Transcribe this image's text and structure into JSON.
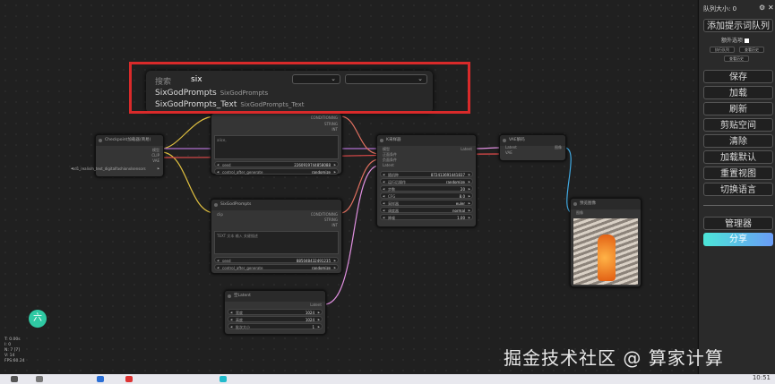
{
  "search": {
    "label": "搜索",
    "query": "six",
    "results": [
      {
        "name": "SixGodPrompts",
        "sub": "SixGodPrompts"
      },
      {
        "name": "SixGodPrompts_Text",
        "sub": "SixGodPrompts_Text"
      }
    ]
  },
  "nodes": {
    "checkpoint": {
      "title": "Checkpoint加载器(简易)",
      "ports": [
        "模型",
        "CLIP",
        "VAE"
      ],
      "widget": "sd1_realism_text_digitalfashionxlsensors"
    },
    "prompt_top": {
      "outputs": [
        "CONDITIONING",
        "STRING",
        "INT"
      ],
      "text": "alice,",
      "seed_label": "seed",
      "seed": "2260919744858088",
      "ctrl_label": "control_after_generate",
      "ctrl": "randomize"
    },
    "sixgod": {
      "title": "SixGodPrompts",
      "input": "clip",
      "outputs": [
        "CONDITIONING",
        "STRING",
        "INT"
      ],
      "placeholder": "TEXT 文本 输入 关键描述",
      "seed_label": "seed",
      "seed": "885048432491235",
      "ctrl_label": "control_after_generate",
      "ctrl": "randomize"
    },
    "ksampler": {
      "title": "K采样器",
      "inputs": [
        "模型",
        "正面条件",
        "负面条件",
        "Latent"
      ],
      "output": "Latent",
      "widgets": [
        {
          "l": "随机种",
          "v": "872413691441837"
        },
        {
          "l": "运行后操作",
          "v": "randomize"
        },
        {
          "l": "步数",
          "v": "20"
        },
        {
          "l": "CFG",
          "v": "8.0"
        },
        {
          "l": "采样器",
          "v": "euler"
        },
        {
          "l": "调度器",
          "v": "normal"
        },
        {
          "l": "降噪",
          "v": "1.00"
        }
      ]
    },
    "vae": {
      "title": "VAE解码",
      "inputs": [
        "Latent",
        "VAE"
      ],
      "output": "图像"
    },
    "preview": {
      "title": "预览图像",
      "input": "图像"
    },
    "latent": {
      "title": "空Latent",
      "output": "Latent",
      "widgets": [
        {
          "l": "宽度",
          "v": "1024"
        },
        {
          "l": "高度",
          "v": "1024"
        },
        {
          "l": "批次大小",
          "v": "1"
        }
      ]
    }
  },
  "menu": {
    "queue": "队列大小: 0",
    "add": "添加提示词队列",
    "extra": "额外选项",
    "small1": "执行队列",
    "small2": "查看历史",
    "small3": "查看历史",
    "buttons": [
      "保存",
      "加载",
      "刷新",
      "剪贴空间",
      "清除",
      "加载默认",
      "重置视图",
      "切换语言"
    ],
    "manager": "管理器",
    "share": "分享"
  },
  "status": [
    "T: 0.00s",
    "I: 0",
    "N: 7 [7]",
    "V: 14",
    "FPS:60.24"
  ],
  "logo": "六",
  "watermark": "掘金技术社区 @ 算家计算",
  "clock": "10:51"
}
